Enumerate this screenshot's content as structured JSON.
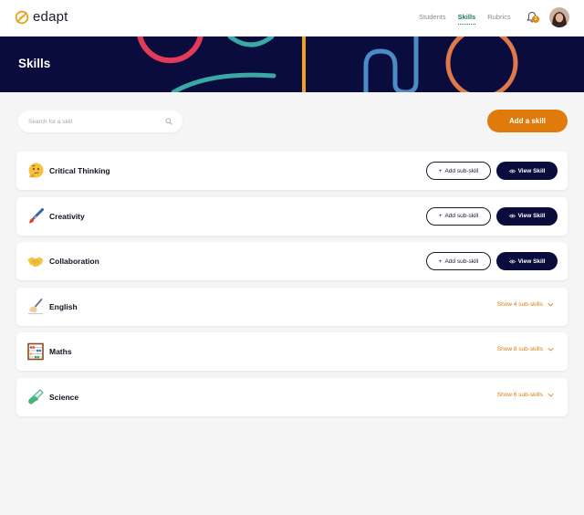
{
  "brand": {
    "name": "edapt",
    "accent": "#e07b0b",
    "navy": "#0a0c3d",
    "green": "#1c7a5c"
  },
  "nav": {
    "links": [
      {
        "label": "Students",
        "active": false
      },
      {
        "label": "Skills",
        "active": true
      },
      {
        "label": "Rubrics",
        "active": false
      }
    ],
    "notifications_count": "1"
  },
  "hero": {
    "title": "Skills"
  },
  "search": {
    "placeholder": "Search for a skill",
    "value": ""
  },
  "actions": {
    "add_skill_label": "Add a skill"
  },
  "skills": [
    {
      "name": "Critical Thinking",
      "icon": "thinking-face-icon",
      "add_sub_label": "Add sub-skill",
      "view_label": "View Skill"
    },
    {
      "name": "Creativity",
      "icon": "paintbrush-icon",
      "add_sub_label": "Add sub-skill",
      "view_label": "View Skill"
    },
    {
      "name": "Collaboration",
      "icon": "handshake-icon",
      "add_sub_label": "Add sub-skill",
      "view_label": "View Skill"
    },
    {
      "name": "English",
      "icon": "writing-hand-icon",
      "show_sub_label": "Show 4 sub-skills"
    },
    {
      "name": "Maths",
      "icon": "abacus-icon",
      "show_sub_label": "Show 8 sub-skills"
    },
    {
      "name": "Science",
      "icon": "test-tube-icon",
      "show_sub_label": "Show 6 sub-skills"
    }
  ]
}
